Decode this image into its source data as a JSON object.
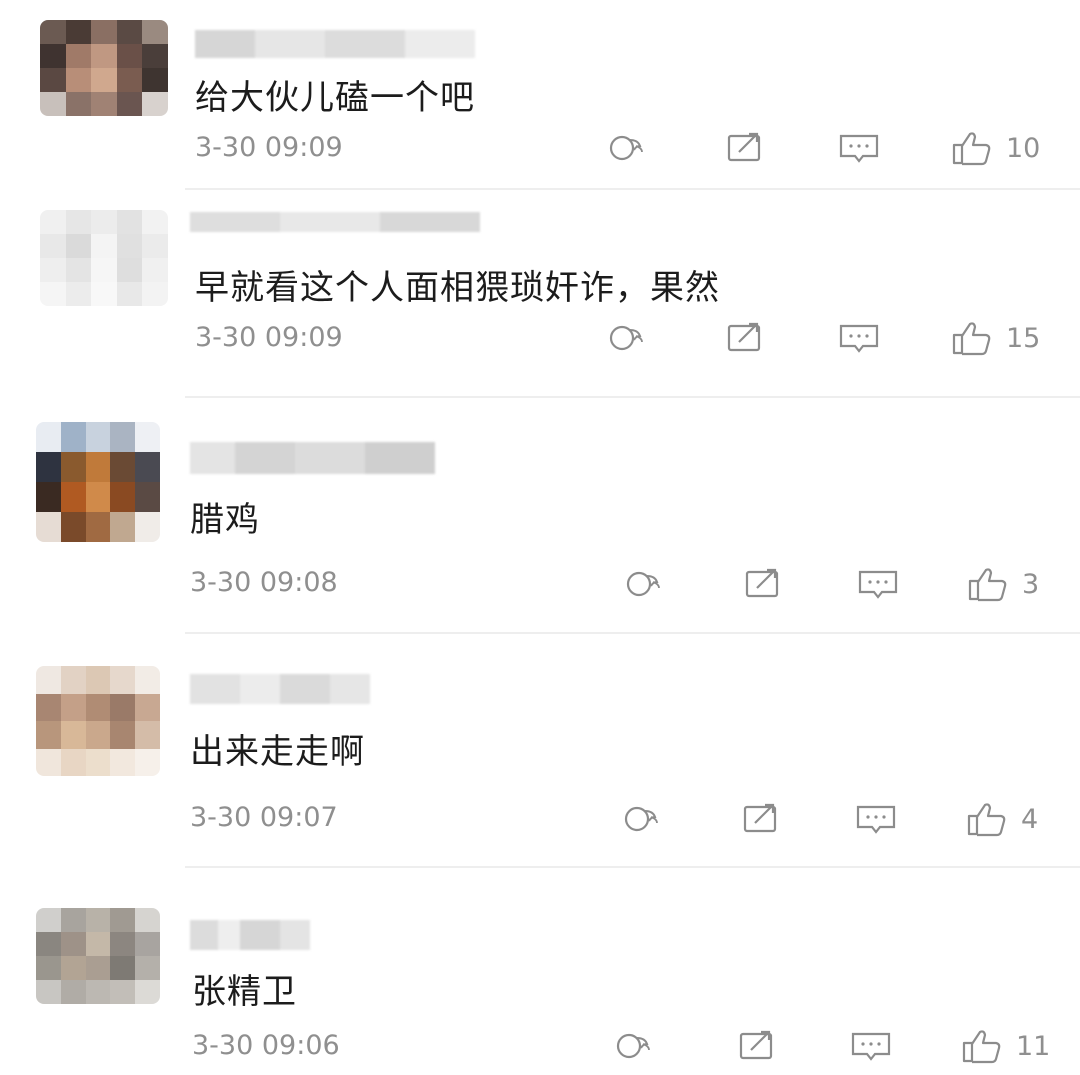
{
  "comments": [
    {
      "text": "给大伙儿磕一个吧",
      "time": "3-30 09:09",
      "likes": "10"
    },
    {
      "text": "早就看这个人面相猥琐奸诈，果然",
      "time": "3-30 09:09",
      "likes": "15"
    },
    {
      "text": "腊鸡",
      "time": "3-30 09:08",
      "likes": "3"
    },
    {
      "text": "出来走走啊",
      "time": "3-30 09:07",
      "likes": "4"
    },
    {
      "text": "张精卫",
      "time": "3-30 09:06",
      "likes": "11"
    }
  ],
  "icons": {
    "react": "react-bubble-icon",
    "share": "share-icon",
    "reply": "reply-icon",
    "like": "thumbs-up-icon"
  }
}
